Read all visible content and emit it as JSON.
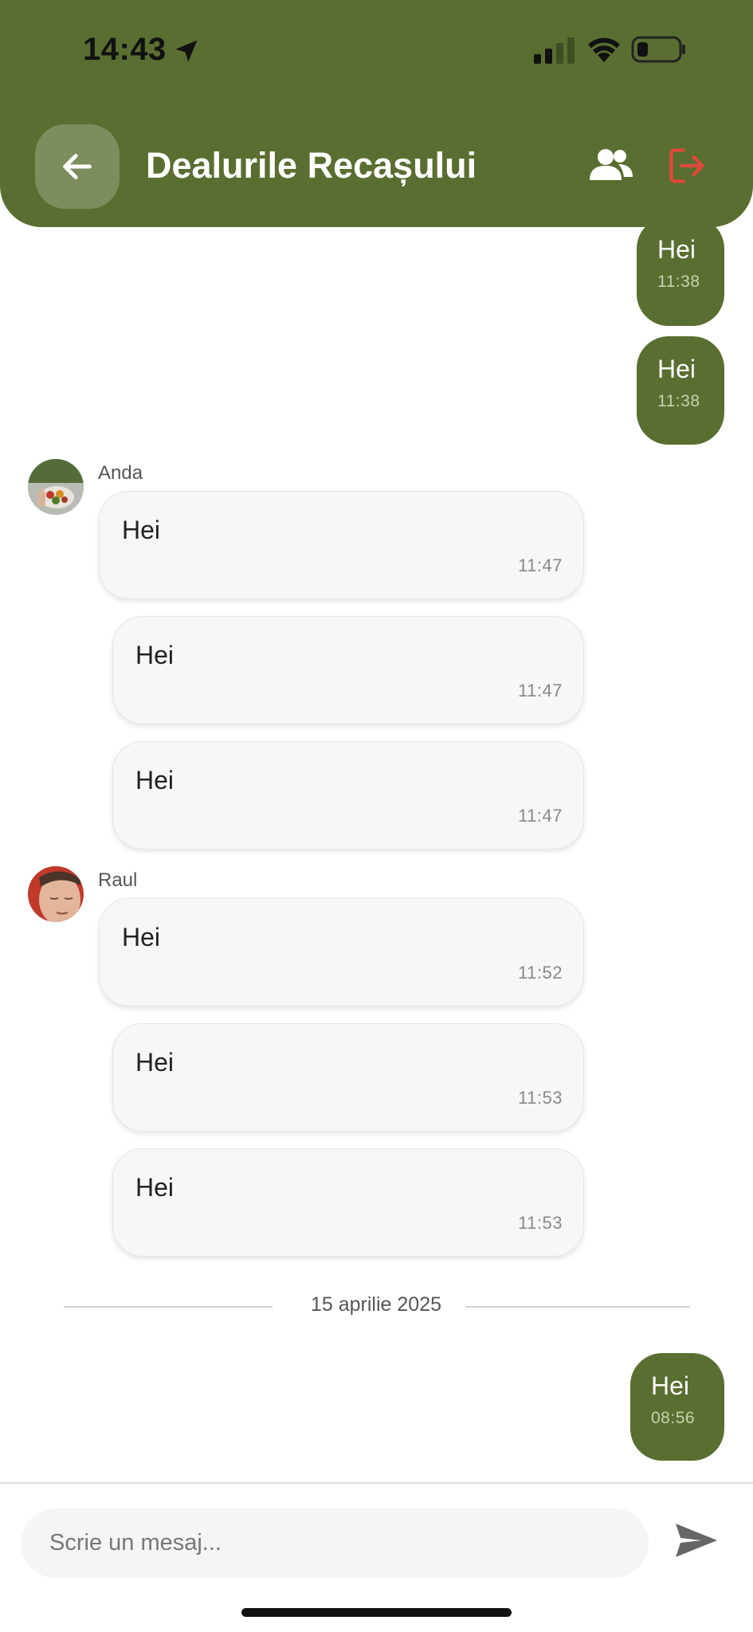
{
  "status_bar": {
    "time": "14:43"
  },
  "header": {
    "title": "Dealurile Recașului"
  },
  "outgoing_top": [
    {
      "text": "Hei",
      "time": "11:38"
    },
    {
      "text": "Hei",
      "time": "11:38"
    }
  ],
  "groups": [
    {
      "sender": "Anda",
      "messages": [
        {
          "text": "Hei",
          "time": "11:47"
        },
        {
          "text": "Hei",
          "time": "11:47"
        },
        {
          "text": "Hei",
          "time": "11:47"
        }
      ]
    },
    {
      "sender": "Raul",
      "messages": [
        {
          "text": "Hei",
          "time": "11:52"
        },
        {
          "text": "Hei",
          "time": "11:53"
        },
        {
          "text": "Hei",
          "time": "11:53"
        }
      ]
    }
  ],
  "date_divider": "15 aprilie 2025",
  "outgoing_bottom": {
    "text": "Hei",
    "time": "08:56"
  },
  "composer": {
    "placeholder": "Scrie un mesaj..."
  },
  "colors": {
    "brand": "#5a6e31",
    "leave_icon": "#e0483a",
    "incoming_bubble": "#f7f7f7"
  },
  "icons": [
    "location-arrow-icon",
    "signal-icon",
    "wifi-icon",
    "battery-icon",
    "back-arrow-icon",
    "group-members-icon",
    "leave-group-icon",
    "send-icon"
  ]
}
